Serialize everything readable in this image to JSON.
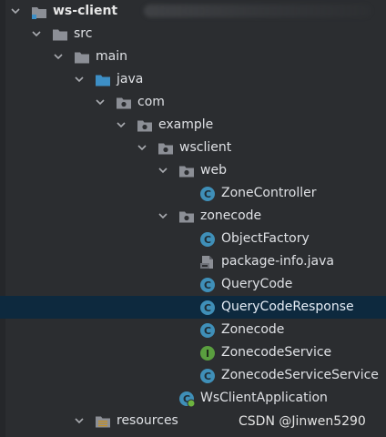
{
  "tree": {
    "root_label": "ws-client",
    "src_label": "src",
    "main_label": "main",
    "java_label": "java",
    "com_label": "com",
    "example_label": "example",
    "wsclient_label": "wsclient",
    "web_label": "web",
    "zone_controller_label": "ZoneController",
    "zonecode_package_label": "zonecode",
    "object_factory_label": "ObjectFactory",
    "package_info_label": "package-info.java",
    "query_code_label": "QueryCode",
    "query_code_response_label": "QueryCodeResponse",
    "zonecode_class_label": "Zonecode",
    "zonecode_service_label": "ZonecodeService",
    "zonecode_service_service_label": "ZonecodeServiceService",
    "ws_client_application_label": "WsClientApplication",
    "resources_label": "resources"
  },
  "icons": {
    "badge_class_letter": "C",
    "badge_interface_letter": "I"
  },
  "watermark": "CSDN @Jinwen5290",
  "colors": {
    "background": "#2b2d30",
    "selection": "#0d293e",
    "folder": "#8c8f96",
    "source_folder": "#3d8fc6",
    "class_badge": "#3f8fb8",
    "interface_badge": "#5a9e3f"
  }
}
